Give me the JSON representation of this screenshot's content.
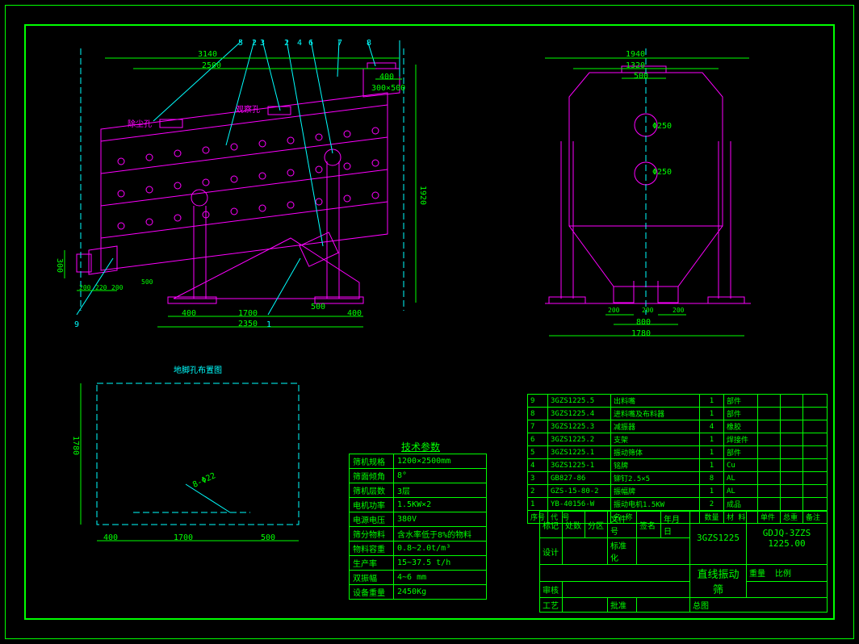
{
  "leaders": {
    "l1": "1",
    "l2": "2",
    "l3": "3",
    "l4": "4",
    "l5": "5",
    "l6": "6",
    "l7": "7",
    "l8": "8",
    "l9": "9"
  },
  "front": {
    "annot1": "除尘孔",
    "annot2": "观察孔",
    "dims": {
      "d3140": "3140",
      "d2500": "2500",
      "d400": "400",
      "d300x500": "300×500",
      "d1920": "1920",
      "d300": "300",
      "d200a": "200",
      "d220": "220",
      "d200b": "200",
      "d500a": "500",
      "d400a": "400",
      "d1700": "1700",
      "d500b": "500",
      "d400b": "400",
      "d2350": "2350"
    }
  },
  "right": {
    "dims": {
      "d1940": "1940",
      "d1320": "1320",
      "d500": "500",
      "d250a": "Φ250",
      "d250b": "Φ250",
      "d200a": "200",
      "d200b": "200",
      "d200c": "200",
      "d800": "800",
      "d1780": "1780"
    }
  },
  "plan": {
    "title": "地脚孔布置图",
    "dims": {
      "d1780": "1780",
      "d8phi22": "8-Φ22",
      "d400": "400",
      "d1700": "1700",
      "d500": "500"
    }
  },
  "params_title": "技术参数",
  "params": [
    [
      "筛机规格",
      "1200×2500mm"
    ],
    [
      "筛面倾角",
      "8°"
    ],
    [
      "筛机层数",
      "3层"
    ],
    [
      "电机功率",
      "1.5KW×2"
    ],
    [
      "电源电压",
      "380V"
    ],
    [
      "筛分物料",
      "含水率低于8%的物料"
    ],
    [
      "物料容重",
      "0.8~2.0t/m³"
    ],
    [
      "生产率",
      "15~37.5 t/h"
    ],
    [
      "双振幅",
      "4~6 mm"
    ],
    [
      "设备重量",
      "2450Kg"
    ]
  ],
  "parts": [
    [
      "9",
      "3GZS1225.5",
      "出料嘴",
      "1",
      "部件",
      "",
      "",
      ""
    ],
    [
      "8",
      "3GZS1225.4",
      "进料嘴及布料器",
      "1",
      "部件",
      "",
      "",
      ""
    ],
    [
      "7",
      "3GZS1225.3",
      "减振器",
      "4",
      "橡胶",
      "",
      "",
      ""
    ],
    [
      "6",
      "3GZS1225.2",
      "支架",
      "1",
      "焊接件",
      "",
      "",
      ""
    ],
    [
      "5",
      "3GZS1225.1",
      "振动筛体",
      "1",
      "部件",
      "",
      "",
      ""
    ],
    [
      "4",
      "3GZS1225-1",
      "铭牌",
      "1",
      "Cu",
      "",
      "",
      ""
    ],
    [
      "3",
      "GB827-86",
      "铆钉2.5×5",
      "8",
      "AL",
      "",
      "",
      ""
    ],
    [
      "2",
      "GZS-15-80-2",
      "振幅牌",
      "1",
      "AL",
      "",
      "",
      ""
    ],
    [
      "1",
      "YB-40156-W",
      "振动电机1.5KW",
      "2",
      "成品",
      "",
      "",
      ""
    ]
  ],
  "parts_head": [
    "序号",
    "代    号",
    "名    称",
    "数量",
    "材  料",
    "单件",
    "总重",
    "备注"
  ],
  "tb": {
    "r1": [
      "标记",
      "处数",
      "分区",
      "文件号",
      "签名",
      "年月日"
    ],
    "model": "3GZS1225",
    "code": "GDJQ-3ZZS 1225.00",
    "r2a": "设计",
    "r2b": "标准化",
    "name": "直线振动筛",
    "weight": "重量",
    "scale": "比例",
    "r3a": "审核",
    "r4a": "工艺",
    "r4b": "批准",
    "type": "总图"
  }
}
